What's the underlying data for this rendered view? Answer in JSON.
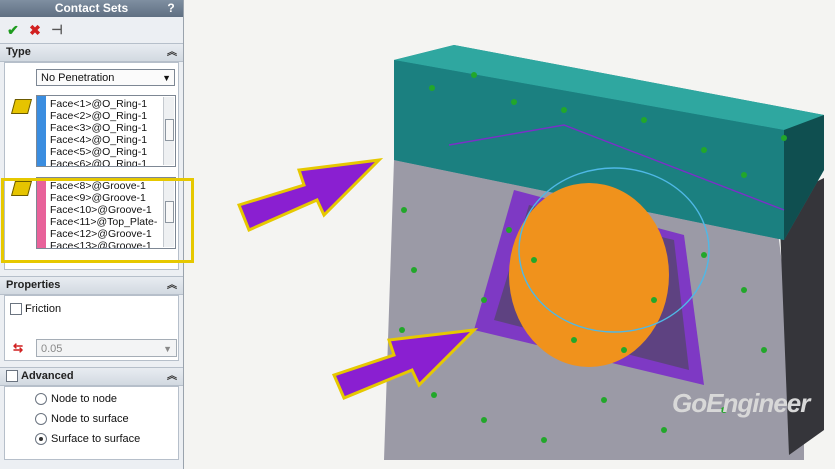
{
  "panel": {
    "title": "Contact Sets",
    "help": "?",
    "toolbar": {
      "ok": "✔",
      "cancel": "✖",
      "pin": "⊣"
    },
    "type_section": {
      "header": "Type",
      "dropdown_value": "No Penetration",
      "set1_items": [
        "Face<1>@O_Ring-1",
        "Face<2>@O_Ring-1",
        "Face<3>@O_Ring-1",
        "Face<4>@O_Ring-1",
        "Face<5>@O_Ring-1",
        "Face<6>@O_Ring-1"
      ],
      "set2_items": [
        "Face<8>@Groove-1",
        "Face<9>@Groove-1",
        "Face<10>@Groove-1",
        "Face<11>@Top_Plate-",
        "Face<12>@Groove-1",
        "Face<13>@Groove-1"
      ],
      "set1_color": "#3a8de0",
      "set2_color": "#e8629a"
    },
    "properties_section": {
      "header": "Properties",
      "friction_label": "Friction",
      "friction_value": "0.05"
    },
    "advanced_section": {
      "header": "Advanced",
      "options": [
        "Node to node",
        "Node to surface",
        "Surface to surface"
      ],
      "selected_option": "Surface to surface"
    }
  },
  "viewport": {
    "watermark": "GoEngineer",
    "highlight_color": "#e6c800",
    "arrow_color": "#8a1fd1",
    "plate_color": "#1f8a8a",
    "body_color": "#9b9aa6",
    "oring_color": "#f0921c"
  }
}
